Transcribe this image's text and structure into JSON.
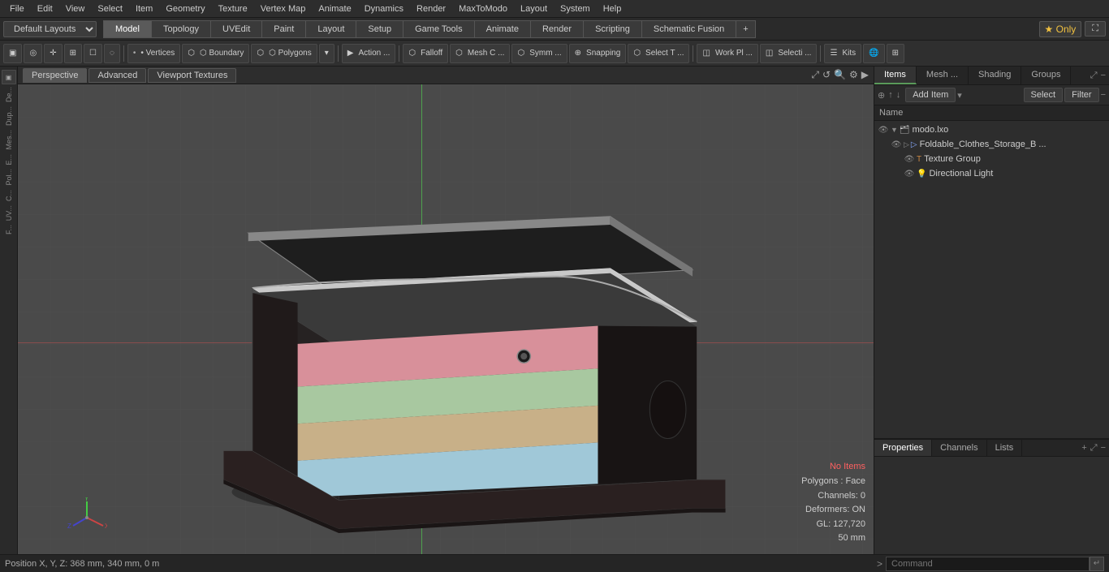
{
  "menu": {
    "items": [
      "File",
      "Edit",
      "View",
      "Select",
      "Item",
      "Geometry",
      "Texture",
      "Vertex Map",
      "Animate",
      "Dynamics",
      "Render",
      "MaxToModo",
      "Layout",
      "System",
      "Help"
    ]
  },
  "layout_bar": {
    "dropdown_label": "Default Layouts ▾",
    "mode_tabs": [
      "Model",
      "Topology",
      "UVEdit",
      "Paint",
      "Layout",
      "Setup",
      "Game Tools",
      "Animate",
      "Render",
      "Scripting",
      "Schematic Fusion"
    ],
    "active_tab": "Model",
    "plus_label": "+",
    "only_label": "★ Only",
    "expand_label": "⛶"
  },
  "toolbar": {
    "tools": [
      {
        "id": "select-mode",
        "label": "▣",
        "icon": "select-mode-icon"
      },
      {
        "id": "sphere",
        "label": "◯",
        "icon": "sphere-icon"
      },
      {
        "id": "cursor",
        "label": "✛",
        "icon": "cursor-icon"
      },
      {
        "id": "transform",
        "label": "⊞",
        "icon": "transform-icon"
      },
      {
        "id": "box",
        "label": "☐",
        "icon": "box-icon"
      },
      {
        "id": "circle2",
        "label": "◌",
        "icon": "circle2-icon"
      },
      {
        "id": "vertices",
        "label": "• Vertices",
        "icon": "vertices-icon",
        "active": false
      },
      {
        "id": "boundary",
        "label": "⬡ Boundary",
        "icon": "boundary-icon"
      },
      {
        "id": "polygons",
        "label": "⬡ Polygons",
        "icon": "polygons-icon"
      },
      {
        "id": "dropdown1",
        "label": "▾",
        "icon": "dropdown1-icon"
      },
      {
        "id": "action",
        "label": "▶ Action ...",
        "icon": "action-icon"
      },
      {
        "id": "falloff",
        "label": "⬡ Falloff",
        "icon": "falloff-icon"
      },
      {
        "id": "meshc",
        "label": "⬡ Mesh C ...",
        "icon": "meshc-icon"
      },
      {
        "id": "symm",
        "label": "⬡ Symm ...",
        "icon": "symm-icon"
      },
      {
        "id": "snapping",
        "label": "⊕ Snapping",
        "icon": "snapping-icon"
      },
      {
        "id": "selectt",
        "label": "⬡ Select T ...",
        "icon": "selectt-icon"
      },
      {
        "id": "workpl",
        "label": "◫ Work Pl ...",
        "icon": "workpl-icon"
      },
      {
        "id": "selecti",
        "label": "◫ Selecti ...",
        "icon": "selecti-icon"
      },
      {
        "id": "kits",
        "label": "☰ Kits",
        "icon": "kits-icon"
      },
      {
        "id": "globe",
        "label": "🌐",
        "icon": "globe-icon"
      },
      {
        "id": "layout2",
        "label": "⊞",
        "icon": "layout2-icon"
      }
    ]
  },
  "viewport": {
    "tabs": [
      "Perspective",
      "Advanced",
      "Viewport Textures"
    ],
    "active_tab": "Perspective",
    "status": {
      "no_items": "No Items",
      "polygons": "Polygons : Face",
      "channels": "Channels: 0",
      "deformers": "Deformers: ON",
      "gl": "GL: 127,720",
      "size": "50 mm"
    },
    "icons": [
      "⤢",
      "↺",
      "🔍",
      "⚙",
      "▶"
    ]
  },
  "items_panel": {
    "tabs": [
      "Items",
      "Mesh ...",
      "Shading",
      "Groups"
    ],
    "active_tab": "Items",
    "toolbar": {
      "add_item_label": "Add Item",
      "dropdown": "▾",
      "select_label": "Select",
      "filter_label": "Filter",
      "minus_label": "−",
      "plus_label": "+",
      "icons": [
        "⊕",
        "↥",
        "↧"
      ]
    },
    "tree": {
      "header": "Name",
      "items": [
        {
          "id": "modo-lxo",
          "label": "modo.lxo",
          "indent": 0,
          "type": "file",
          "icon": "🗂",
          "expanded": true,
          "eye": true
        },
        {
          "id": "foldable-clothes",
          "label": "Foldable_Clothes_Storage_B ...",
          "indent": 1,
          "type": "mesh",
          "icon": "▷",
          "eye": true
        },
        {
          "id": "texture-group",
          "label": "Texture Group",
          "indent": 2,
          "type": "texture",
          "icon": "T",
          "eye": true
        },
        {
          "id": "directional-light",
          "label": "Directional Light",
          "indent": 2,
          "type": "light",
          "icon": "💡",
          "eye": true
        }
      ]
    }
  },
  "properties_panel": {
    "tabs": [
      "Properties",
      "Channels",
      "Lists"
    ],
    "active_tab": "Properties",
    "plus_label": "+"
  },
  "bottom_bar": {
    "position_text": "Position X, Y, Z:  368 mm, 340 mm, 0 m",
    "command_prompt": ">",
    "command_placeholder": "Command",
    "command_go_label": "↵"
  },
  "left_sidebar": {
    "labels": [
      "De...",
      "Dup...",
      "Mes...",
      "E...",
      "Pol...",
      "C...",
      "UV...",
      "F..."
    ]
  },
  "colors": {
    "accent_green": "#5a9a5a",
    "accent_blue": "#3a5a7a",
    "bg_dark": "#2d2d2d",
    "bg_mid": "#3a3a3a",
    "viewport_bg": "#4a4a4a"
  }
}
